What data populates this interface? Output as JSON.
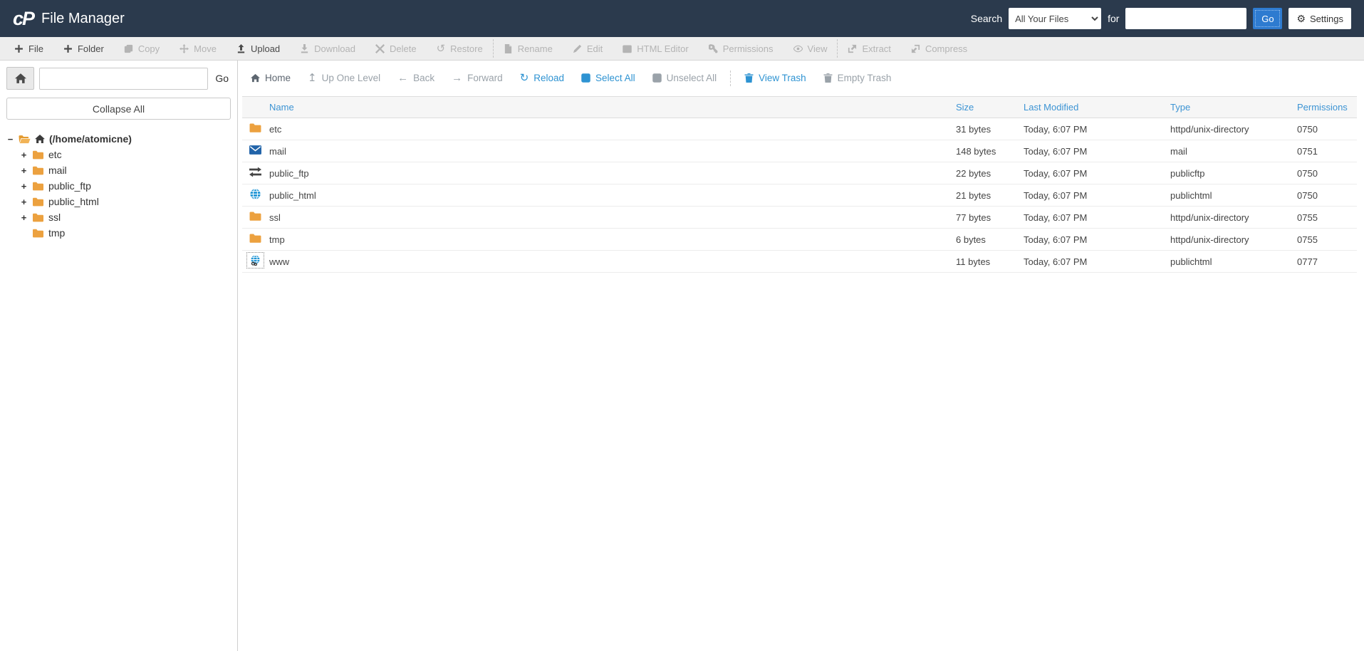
{
  "colors": {
    "header_bg": "#2b3a4d",
    "accent_blue": "#2e93d2",
    "go_button_blue": "#2e7bd0",
    "table_header_blue": "#3d94d4",
    "folder_orange": "#eca13f",
    "mail_blue": "#2264a9",
    "globe_blue": "#2196d6"
  },
  "header": {
    "app_title": "File Manager",
    "search_label": "Search",
    "search_scope_selected": "All Your Files",
    "for_label": "for",
    "search_value": "",
    "go_label": "Go",
    "settings_label": "Settings"
  },
  "toolbar": {
    "groups": [
      {
        "items": [
          {
            "label": "File",
            "icon": "plus-icon",
            "enabled": true
          },
          {
            "label": "Folder",
            "icon": "plus-icon",
            "enabled": true
          },
          {
            "label": "Copy",
            "icon": "copy-icon",
            "enabled": false
          },
          {
            "label": "Move",
            "icon": "move-icon",
            "enabled": false
          },
          {
            "label": "Upload",
            "icon": "upload-icon",
            "enabled": true
          },
          {
            "label": "Download",
            "icon": "download-icon",
            "enabled": false
          },
          {
            "label": "Delete",
            "icon": "delete-icon",
            "enabled": false
          },
          {
            "label": "Restore",
            "icon": "restore-icon",
            "enabled": false
          }
        ]
      },
      {
        "items": [
          {
            "label": "Rename",
            "icon": "file-icon",
            "enabled": false
          },
          {
            "label": "Edit",
            "icon": "pencil-icon",
            "enabled": false
          },
          {
            "label": "HTML Editor",
            "icon": "html-editor-icon",
            "enabled": false
          },
          {
            "label": "Permissions",
            "icon": "key-icon",
            "enabled": false
          },
          {
            "label": "View",
            "icon": "eye-icon",
            "enabled": false
          }
        ]
      },
      {
        "items": [
          {
            "label": "Extract",
            "icon": "extract-icon",
            "enabled": false
          },
          {
            "label": "Compress",
            "icon": "compress-icon",
            "enabled": false
          }
        ]
      }
    ]
  },
  "sidebar": {
    "search_value": "",
    "go_label": "Go",
    "collapse_all_label": "Collapse All",
    "tree": [
      {
        "label": "(/home/atomicne)",
        "toggle": "−",
        "icon": "folder-open-icon",
        "home_icon": true,
        "bold": true,
        "level": 0
      },
      {
        "label": "etc",
        "toggle": "+",
        "icon": "folder-icon",
        "level": 1
      },
      {
        "label": "mail",
        "toggle": "+",
        "icon": "folder-icon",
        "level": 1
      },
      {
        "label": "public_ftp",
        "toggle": "+",
        "icon": "folder-icon",
        "level": 1
      },
      {
        "label": "public_html",
        "toggle": "+",
        "icon": "folder-icon",
        "level": 1
      },
      {
        "label": "ssl",
        "toggle": "+",
        "icon": "folder-icon",
        "level": 1
      },
      {
        "label": "tmp",
        "toggle": "",
        "icon": "folder-icon",
        "level": 1
      }
    ]
  },
  "nav": {
    "items": [
      {
        "label": "Home",
        "icon": "home-icon",
        "state": "default"
      },
      {
        "label": "Up One Level",
        "icon": "up-arrow-icon",
        "state": "muted"
      },
      {
        "label": "Back",
        "icon": "back-arrow-icon",
        "state": "muted"
      },
      {
        "label": "Forward",
        "icon": "forward-arrow-icon",
        "state": "muted"
      },
      {
        "label": "Reload",
        "icon": "reload-icon",
        "state": "link"
      },
      {
        "label": "Select All",
        "icon": "checkbox-checked-icon",
        "state": "link"
      },
      {
        "label": "Unselect All",
        "icon": "checkbox-empty-icon",
        "state": "muted"
      },
      {
        "label": "View Trash",
        "icon": "trash-icon",
        "state": "link",
        "separator_before": true
      },
      {
        "label": "Empty Trash",
        "icon": "trash-icon",
        "state": "muted"
      }
    ]
  },
  "table": {
    "columns": [
      "Name",
      "Size",
      "Last Modified",
      "Type",
      "Permissions"
    ],
    "rows": [
      {
        "name": "etc",
        "icon": "folder-icon",
        "size": "31 bytes",
        "modified": "Today, 6:07 PM",
        "type": "httpd/unix-directory",
        "permissions": "0750"
      },
      {
        "name": "mail",
        "icon": "mail-icon",
        "size": "148 bytes",
        "modified": "Today, 6:07 PM",
        "type": "mail",
        "permissions": "0751"
      },
      {
        "name": "public_ftp",
        "icon": "transfer-icon",
        "size": "22 bytes",
        "modified": "Today, 6:07 PM",
        "type": "publicftp",
        "permissions": "0750"
      },
      {
        "name": "public_html",
        "icon": "globe-icon",
        "size": "21 bytes",
        "modified": "Today, 6:07 PM",
        "type": "publichtml",
        "permissions": "0750"
      },
      {
        "name": "ssl",
        "icon": "folder-icon",
        "size": "77 bytes",
        "modified": "Today, 6:07 PM",
        "type": "httpd/unix-directory",
        "permissions": "0755"
      },
      {
        "name": "tmp",
        "icon": "folder-icon",
        "size": "6 bytes",
        "modified": "Today, 6:07 PM",
        "type": "httpd/unix-directory",
        "permissions": "0755"
      },
      {
        "name": "www",
        "icon": "globe-link-icon",
        "size": "11 bytes",
        "modified": "Today, 6:07 PM",
        "type": "publichtml",
        "permissions": "0777",
        "focused": true
      }
    ]
  }
}
